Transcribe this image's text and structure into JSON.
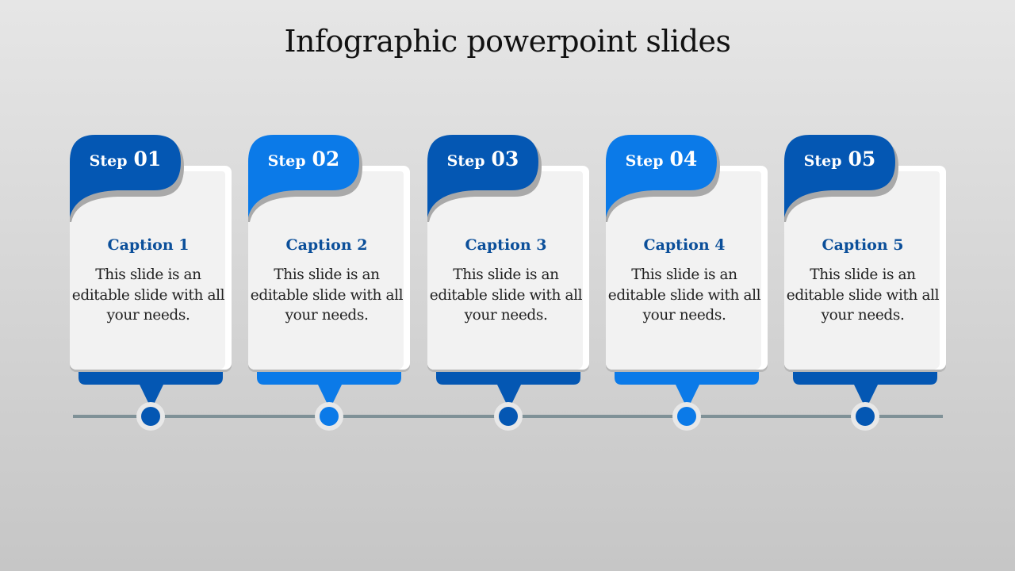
{
  "title": "Infographic powerpoint slides",
  "colors": {
    "dark_blue": "#0457b3",
    "light_blue": "#0b7ae8",
    "caption_text": "#0b4f9a",
    "timeline": "#7f9197"
  },
  "steps": [
    {
      "word": "Step",
      "number": "01",
      "caption": "Caption 1",
      "text": "This slide is an editable slide with all your needs.",
      "color": "#0457b3"
    },
    {
      "word": "Step",
      "number": "02",
      "caption": "Caption 2",
      "text": "This slide is an editable slide with all your needs.",
      "color": "#0b7ae8"
    },
    {
      "word": "Step",
      "number": "03",
      "caption": "Caption 3",
      "text": "This slide is an editable slide with all your needs.",
      "color": "#0457b3"
    },
    {
      "word": "Step",
      "number": "04",
      "caption": "Caption 4",
      "text": "This slide is an editable slide with all your needs.",
      "color": "#0b7ae8"
    },
    {
      "word": "Step",
      "number": "05",
      "caption": "Caption 5",
      "text": "This slide is an editable slide with all your needs.",
      "color": "#0457b3"
    }
  ]
}
